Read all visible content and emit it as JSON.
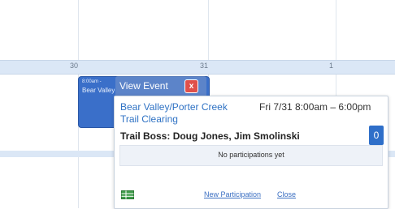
{
  "calendar": {
    "dates": [
      "30",
      "31",
      "1"
    ]
  },
  "event_chip": {
    "time": "8:00am -",
    "title": "Bear Valley/Porter Creek Trail Clearing"
  },
  "popup": {
    "header_title": "View Event",
    "close_glyph": "x",
    "event_title": "Bear Valley/Porter Creek Trail Clearing",
    "event_date": "Fri 7/31  8:00am – 6:00pm",
    "participant_count": "0",
    "trail_boss": "Trail Boss: Doug Jones, Jim Smolinski",
    "participations_status": "No participations yet",
    "new_participation_link": "New Participation",
    "close_link": "Close",
    "icon": "spreadsheet-icon"
  },
  "colors": {
    "accent": "#2f6fc9",
    "close_button": "#e0504a",
    "header_band": "#dbe7f6"
  }
}
